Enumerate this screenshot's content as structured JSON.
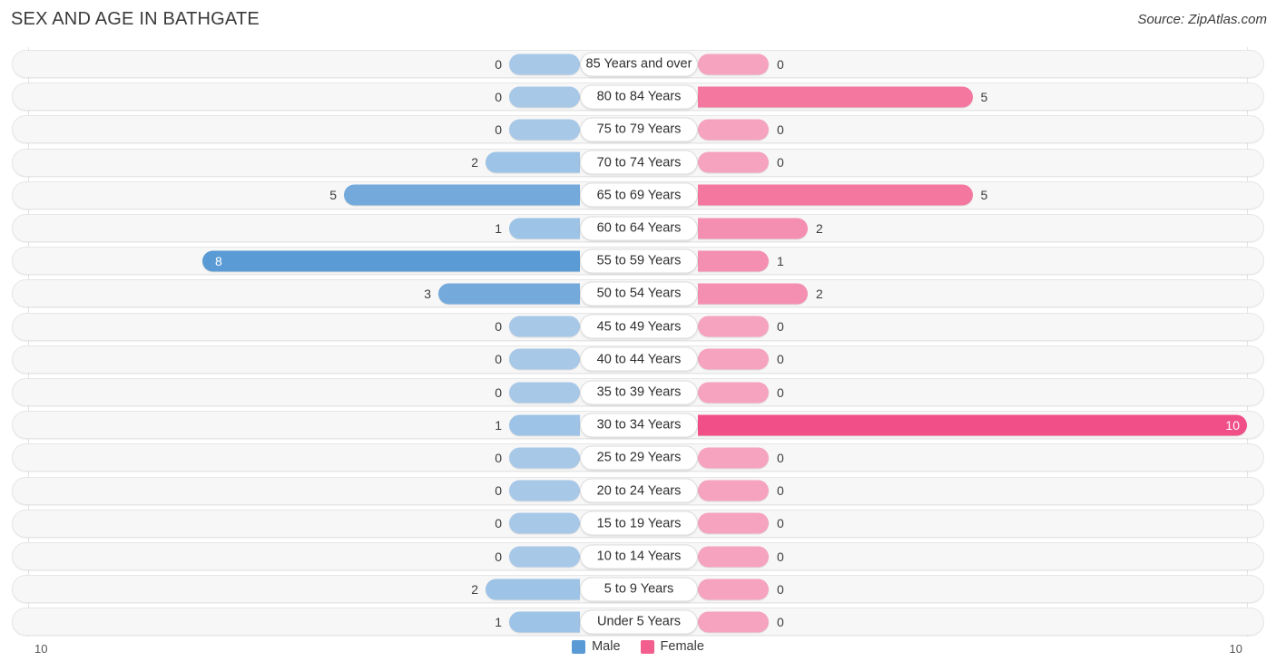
{
  "header": {
    "title": "SEX AND AGE IN BATHGATE",
    "source": "Source: ZipAtlas.com"
  },
  "legend": {
    "male_label": "Male",
    "female_label": "Female",
    "male_color": "#5b9bd5",
    "female_color": "#f25f8e"
  },
  "axis": {
    "left_tick": "10",
    "right_tick": "10",
    "max": 10
  },
  "chart_data": {
    "type": "bar",
    "title": "SEX AND AGE IN BATHGATE",
    "subtitle": "Source: ZipAtlas.com",
    "orientation": "horizontal-diverging",
    "xlabel": "",
    "ylabel": "",
    "xlim": [
      10,
      10
    ],
    "grid": false,
    "legend_position": "bottom-center",
    "categories": [
      "85 Years and over",
      "80 to 84 Years",
      "75 to 79 Years",
      "70 to 74 Years",
      "65 to 69 Years",
      "60 to 64 Years",
      "55 to 59 Years",
      "50 to 54 Years",
      "45 to 49 Years",
      "40 to 44 Years",
      "35 to 39 Years",
      "30 to 34 Years",
      "25 to 29 Years",
      "20 to 24 Years",
      "15 to 19 Years",
      "10 to 14 Years",
      "5 to 9 Years",
      "Under 5 Years"
    ],
    "series": [
      {
        "name": "Male",
        "values": [
          0,
          0,
          0,
          2,
          5,
          1,
          8,
          3,
          0,
          0,
          0,
          1,
          0,
          0,
          0,
          0,
          2,
          1
        ]
      },
      {
        "name": "Female",
        "values": [
          0,
          5,
          0,
          0,
          5,
          2,
          1,
          2,
          0,
          0,
          0,
          10,
          0,
          0,
          0,
          0,
          0,
          0
        ]
      }
    ]
  },
  "rows": [
    {
      "label": "85 Years and over",
      "male": "0",
      "female": "0"
    },
    {
      "label": "80 to 84 Years",
      "male": "0",
      "female": "5"
    },
    {
      "label": "75 to 79 Years",
      "male": "0",
      "female": "0"
    },
    {
      "label": "70 to 74 Years",
      "male": "2",
      "female": "0"
    },
    {
      "label": "65 to 69 Years",
      "male": "5",
      "female": "5"
    },
    {
      "label": "60 to 64 Years",
      "male": "1",
      "female": "2"
    },
    {
      "label": "55 to 59 Years",
      "male": "8",
      "female": "1"
    },
    {
      "label": "50 to 54 Years",
      "male": "3",
      "female": "2"
    },
    {
      "label": "45 to 49 Years",
      "male": "0",
      "female": "0"
    },
    {
      "label": "40 to 44 Years",
      "male": "0",
      "female": "0"
    },
    {
      "label": "35 to 39 Years",
      "male": "0",
      "female": "0"
    },
    {
      "label": "30 to 34 Years",
      "male": "1",
      "female": "10"
    },
    {
      "label": "25 to 29 Years",
      "male": "0",
      "female": "0"
    },
    {
      "label": "20 to 24 Years",
      "male": "0",
      "female": "0"
    },
    {
      "label": "15 to 19 Years",
      "male": "0",
      "female": "0"
    },
    {
      "label": "10 to 14 Years",
      "male": "0",
      "female": "0"
    },
    {
      "label": "5 to 9 Years",
      "male": "2",
      "female": "0"
    },
    {
      "label": "Under 5 Years",
      "male": "1",
      "female": "0"
    }
  ]
}
